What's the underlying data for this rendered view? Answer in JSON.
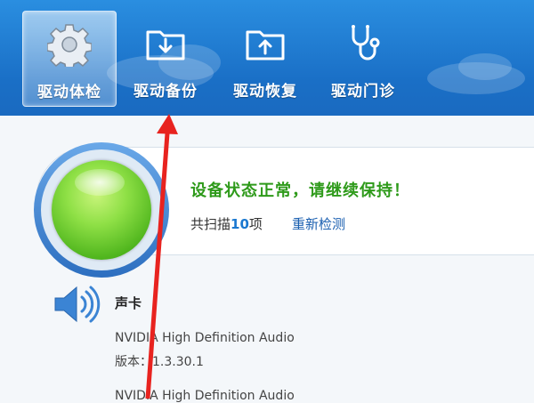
{
  "nav": {
    "items": [
      {
        "label": "驱动体检",
        "icon": "gear-icon",
        "active": true
      },
      {
        "label": "驱动备份",
        "icon": "download-folder-icon",
        "active": false
      },
      {
        "label": "驱动恢复",
        "icon": "upload-folder-icon",
        "active": false
      },
      {
        "label": "驱动门诊",
        "icon": "stethoscope-icon",
        "active": false
      }
    ]
  },
  "status": {
    "title": "设备状态正常，请继续保持！",
    "scan_prefix": "共扫描",
    "scan_count": "10",
    "scan_suffix": "项",
    "rescan_label": "重新检测"
  },
  "devices": {
    "section_title": "声卡",
    "items": [
      {
        "name": "NVIDIA High Definition Audio",
        "version": "版本：1.3.30.1"
      },
      {
        "name": "NVIDIA High Definition Audio"
      }
    ]
  },
  "colors": {
    "header": "#1a6fc6",
    "status_green": "#2e9a1a",
    "link_blue": "#1a5fb0",
    "annotation_red": "#e8231f"
  }
}
